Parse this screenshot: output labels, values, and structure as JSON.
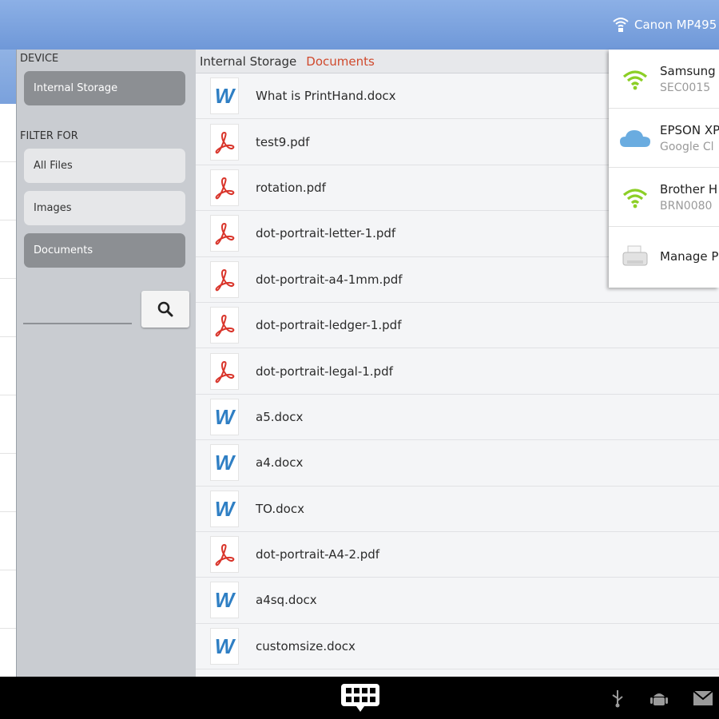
{
  "header": {
    "printer_label": "Canon MP495"
  },
  "sidebar": {
    "device_label": "DEVICE",
    "device_button": "Internal Storage",
    "filter_label": "FILTER FOR",
    "filters": [
      "All Files",
      "Images",
      "Documents"
    ],
    "active_filter": "Documents",
    "search_value": ""
  },
  "breadcrumb": {
    "root": "Internal Storage",
    "current": "Documents"
  },
  "files": [
    {
      "name": "What is PrintHand.docx",
      "type": "word"
    },
    {
      "name": "test9.pdf",
      "type": "pdf"
    },
    {
      "name": "rotation.pdf",
      "type": "pdf"
    },
    {
      "name": "dot-portrait-letter-1.pdf",
      "type": "pdf"
    },
    {
      "name": "dot-portrait-a4-1mm.pdf",
      "type": "pdf"
    },
    {
      "name": "dot-portrait-ledger-1.pdf",
      "type": "pdf"
    },
    {
      "name": "dot-portrait-legal-1.pdf",
      "type": "pdf"
    },
    {
      "name": "a5.docx",
      "type": "word"
    },
    {
      "name": "a4.docx",
      "type": "word"
    },
    {
      "name": "TO.docx",
      "type": "word"
    },
    {
      "name": "dot-portrait-A4-2.pdf",
      "type": "pdf"
    },
    {
      "name": "a4sq.docx",
      "type": "word"
    },
    {
      "name": "customsize.docx",
      "type": "word"
    }
  ],
  "printers_menu": {
    "items": [
      {
        "name": "Samsung",
        "sub": "SEC0015",
        "icon": "wifi-icon"
      },
      {
        "name": "EPSON XP",
        "sub": "Google Cl",
        "icon": "cloud-icon"
      },
      {
        "name": "Brother H",
        "sub": "BRN0080",
        "icon": "wifi-icon"
      }
    ],
    "manage_label": "Manage P"
  },
  "colors": {
    "topbar": "#7aa1dc",
    "accent_red": "#d0492c",
    "wifi_green": "#8ccf26",
    "cloud_blue": "#6aace0",
    "word_blue": "#2f7fc4",
    "pdf_red": "#d9352b"
  }
}
